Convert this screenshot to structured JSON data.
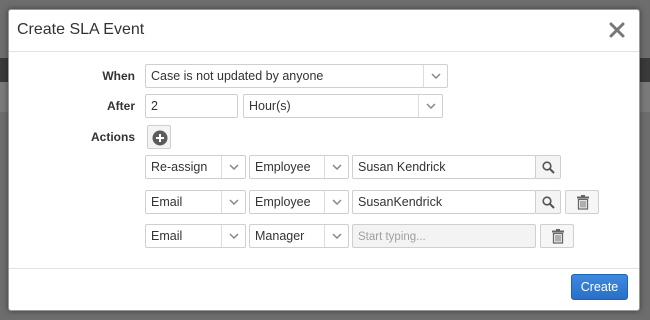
{
  "dialog": {
    "title": "Create SLA Event",
    "close_icon": "close-icon"
  },
  "form": {
    "when": {
      "label": "When",
      "value": "Case is not updated by anyone"
    },
    "after": {
      "label": "After",
      "amount": "2",
      "unit": "Hour(s)"
    },
    "actions": {
      "label": "Actions",
      "add_icon": "plus-circle-icon",
      "rows": [
        {
          "action": "Re-assign",
          "target_type": "Employee",
          "value": "Susan Kendrick",
          "placeholder": "",
          "has_search": true,
          "has_delete": false
        },
        {
          "action": "Email",
          "target_type": "Employee",
          "value": "SusanKendrick",
          "placeholder": "",
          "has_search": true,
          "has_delete": true
        },
        {
          "action": "Email",
          "target_type": "Manager",
          "value": "",
          "placeholder": "Start typing...",
          "has_search": false,
          "has_delete": true
        }
      ]
    }
  },
  "footer": {
    "create_label": "Create"
  },
  "colors": {
    "primary": "#2f7bd6",
    "backdrop": "#6d6d6d"
  }
}
